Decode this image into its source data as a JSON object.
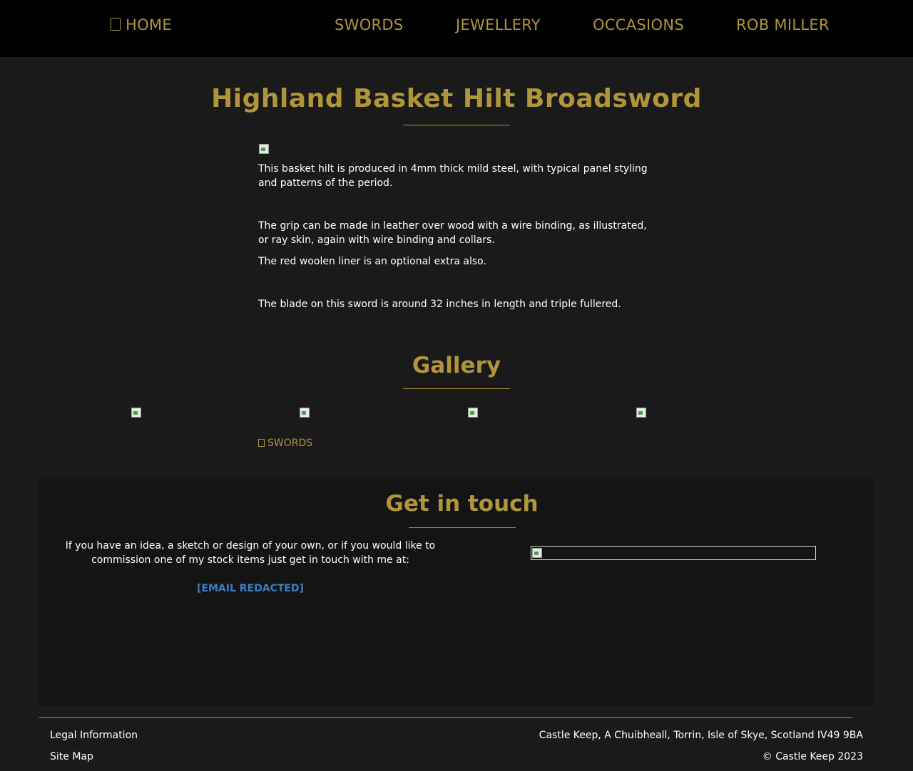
{
  "nav": {
    "home": "HOME",
    "swords": "SWORDS",
    "jewellery": "JEWELLERY",
    "occasions": "OCCASIONS",
    "rob_miller": "ROB MILLER"
  },
  "product": {
    "title": "Highland Basket Hilt Broadsword",
    "paragraphs": [
      "This basket hilt is produced in 4mm thick mild steel, with typical panel styling and patterns of the period.",
      "The grip can be made in leather over wood with a wire binding, as illustrated, or ray skin, again with wire binding and collars.",
      "The red woolen liner is an optional extra also.",
      "The blade on this sword is around 32 inches in length and triple fullered."
    ]
  },
  "gallery": {
    "title": "Gallery",
    "image_count": 4
  },
  "back_link": {
    "label": "SWORDS"
  },
  "contact": {
    "title": "Get in touch",
    "text": "If you have an idea, a sketch or design of your own, or if you would like to commission one of my stock items just get in touch with me at:",
    "email": "[EMAIL REDACTED]"
  },
  "footer": {
    "legal": "Legal Information",
    "sitemap": "Site Map",
    "address": "Castle Keep, A Chuibheall, Torrin, Isle of Skye, Scotland IV49 9BA",
    "copyright": "© Castle Keep 2023"
  },
  "colors": {
    "accent": "#b0953a",
    "background": "#1a1a1a",
    "header": "#000000",
    "panel": "#141414",
    "link": "#3a7fc4"
  }
}
